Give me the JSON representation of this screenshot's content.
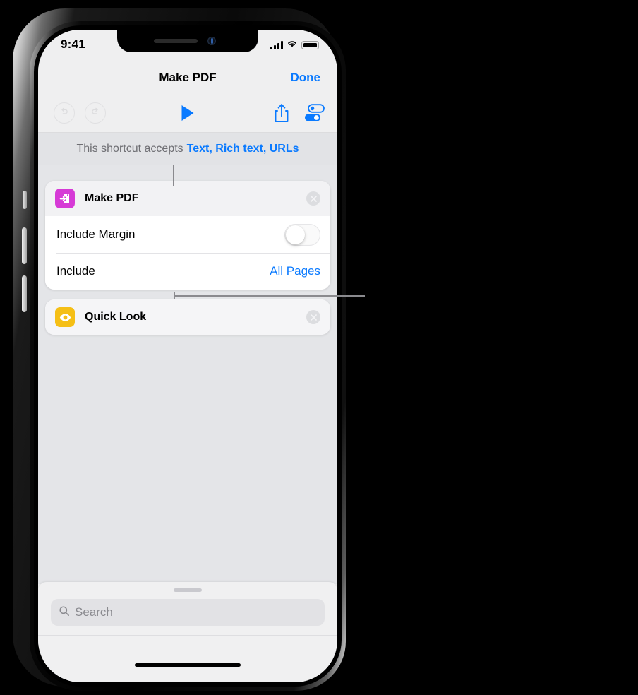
{
  "status_bar": {
    "time": "9:41",
    "cellular_icon": "signal-bars-icon",
    "wifi_icon": "wifi-icon",
    "battery_icon": "battery-full-icon"
  },
  "nav_bar": {
    "title": "Make PDF",
    "done_label": "Done"
  },
  "toolbar": {
    "undo_icon": "undo-icon",
    "redo_icon": "redo-icon",
    "run_icon": "play-icon",
    "share_icon": "share-icon",
    "settings_icon": "sliders-icon"
  },
  "accepts_banner": {
    "prefix": "This shortcut accepts",
    "types": "Text, Rich text, URLs"
  },
  "actions": [
    {
      "icon_name": "make-pdf-icon",
      "title": "Make PDF",
      "icon_color": "#d63ad6",
      "remove_icon": "close-circle-icon",
      "parameters": [
        {
          "label": "Include Margin",
          "control": "toggle",
          "value": "off"
        },
        {
          "label": "Include",
          "control": "value",
          "value": "All Pages"
        }
      ]
    },
    {
      "icon_name": "quick-look-icon",
      "title": "Quick Look",
      "icon_color": "#f5bf16",
      "remove_icon": "close-circle-icon",
      "parameters": []
    }
  ],
  "search_drawer": {
    "grabber": "drawer-grabber",
    "search_icon": "search-icon",
    "placeholder": "Search"
  },
  "colors": {
    "accent_blue": "#0a7aff",
    "content_background": "#e4e5e8",
    "chrome_background": "#efeff0",
    "banner_background": "#e2e3e6"
  }
}
